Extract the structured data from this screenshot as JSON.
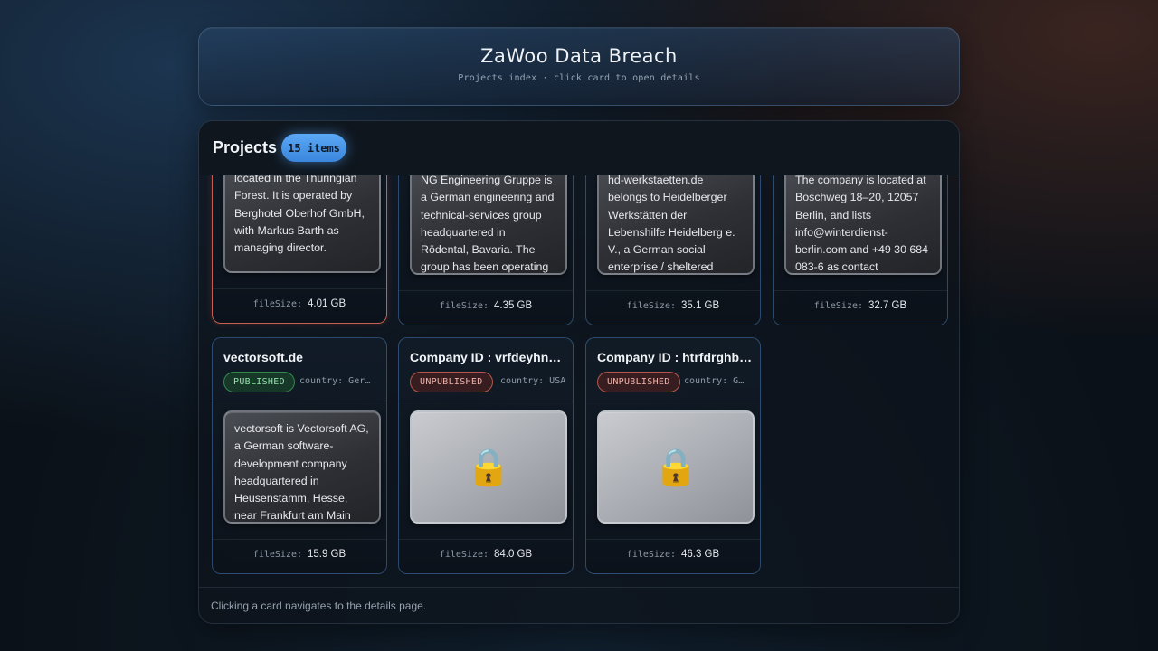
{
  "header": {
    "title": "ZaWoo Data Breach",
    "subtitle": "Projects index · click card to open details"
  },
  "projects_panel": {
    "title": "Projects",
    "count_badge": "15 items",
    "footer_note": "Clicking a card navigates to the details page."
  },
  "filesize_label": "fileSize:",
  "lock_icon_glyph": "🔒",
  "colors": {
    "accent": "#4a97ea",
    "published": "#8fe0a6",
    "unpublished": "#f0b2a8",
    "selected_border": "#e66e5a"
  },
  "cards_row1": [
    {
      "description": "located in the Thuringian Forest. It is operated by Berghotel Oberhof GmbH, with Markus Barth as managing director.",
      "filesize": "4.01 GB",
      "selected": true
    },
    {
      "description": "NG Engineering Gruppe is a German engineering and technical-services group headquartered in Rödental, Bavaria. The group has been operating",
      "filesize": "4.35 GB",
      "selected": false
    },
    {
      "description": "hd-werkstaetten.de belongs to Heidelberger Werkstätten der Lebenshilfe Heidelberg e. V., a German social enterprise / sheltered",
      "filesize": "35.1 GB",
      "selected": false
    },
    {
      "description": "The company is located at Boschweg 18–20, 12057 Berlin, and lists info@winterdienst-berlin.com and +49 30 684 083-6 as contact",
      "filesize": "32.7 GB",
      "selected": false
    }
  ],
  "cards_row2": [
    {
      "title": "vectorsoft.de",
      "status": "PUBLISHED",
      "country": "country: Ger…",
      "description": "vectorsoft is Vectorsoft AG, a German software-development company headquartered in Heusenstamm, Hesse, near Frankfurt am Main",
      "filesize": "15.9 GB",
      "icon": "lock-icon"
    },
    {
      "title": "Company ID : vrfdeyhnbgtr",
      "status": "UNPUBLISHED",
      "country": "country: USA",
      "description": "",
      "filesize": "84.0 GB",
      "icon": "lock-icon"
    },
    {
      "title": "Company ID : htrfdrghbtyu",
      "status": "UNPUBLISHED",
      "country": "country: G…",
      "description": "",
      "filesize": "46.3 GB",
      "icon": "lock-icon"
    }
  ]
}
